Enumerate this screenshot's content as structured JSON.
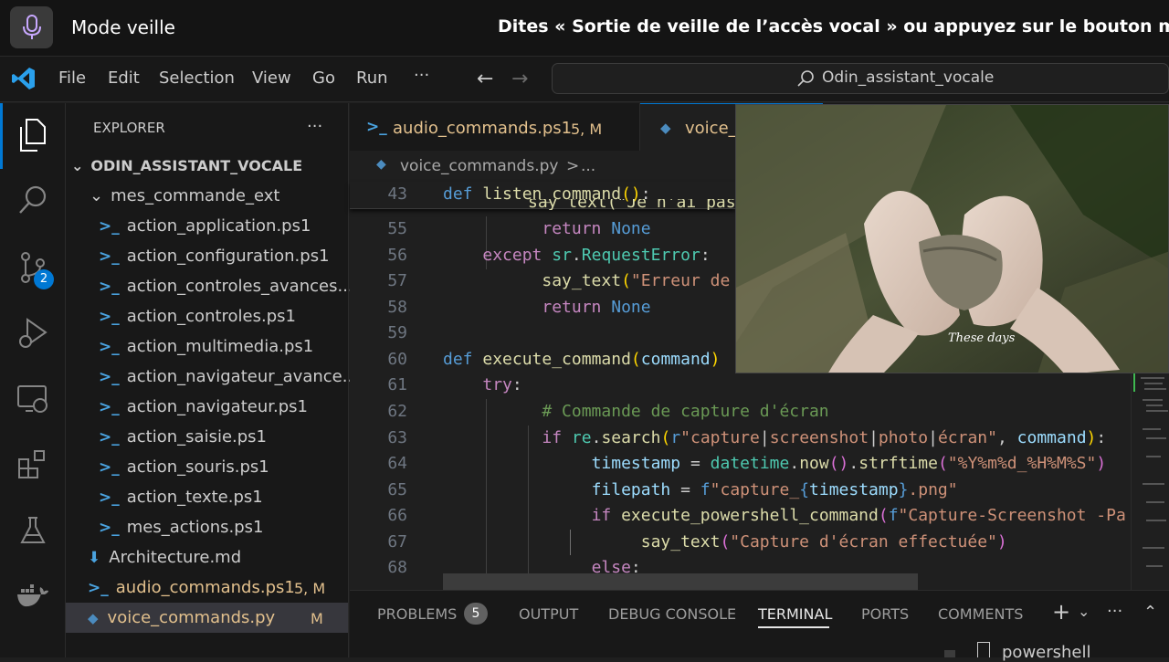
{
  "voice_bar": {
    "mode": "Mode veille",
    "hint": "Dites « Sortie de veille de l’accès vocal » ou appuyez sur le bouton micro pour"
  },
  "menu": {
    "items": [
      "File",
      "Edit",
      "Selection",
      "View",
      "Go",
      "Run",
      "···"
    ],
    "search_text": "Odin_assistant_vocale"
  },
  "explorer": {
    "title": "EXPLORER",
    "more": "···",
    "root": "ODIN_ASSISTANT_VOCALE",
    "folder": "mes_commande_ext",
    "files": [
      "action_application.ps1",
      "action_configuration.ps1",
      "action_controles_avances....",
      "action_controles.ps1",
      "action_multimedia.ps1",
      "action_navigateur_avance....",
      "action_navigateur.ps1",
      "action_saisie.ps1",
      "action_souris.ps1",
      "action_texte.ps1",
      "mes_actions.ps1"
    ],
    "architecture": "Architecture.md",
    "audio_file": "audio_commands.ps1",
    "audio_badge": "5, M",
    "voice_file": "voice_commands.py",
    "voice_badge": "M"
  },
  "activity": {
    "scm_badge": "2"
  },
  "tabs": {
    "tab1_label": "audio_commands.ps1",
    "tab1_badge": "5, M",
    "tab2_label": "voice_c"
  },
  "breadcrumb": {
    "file": "voice_commands.py",
    "sep": ">",
    "rest": "..."
  },
  "code": {
    "sticky_line": "43",
    "line_numbers": [
      "55",
      "56",
      "57",
      "58",
      "59",
      "60",
      "61",
      "62",
      "63",
      "64",
      "65",
      "66",
      "67",
      "68"
    ]
  },
  "video": {
    "caption": "These days"
  },
  "panel": {
    "tabs": [
      "PROBLEMS",
      "OUTPUT",
      "DEBUG CONSOLE",
      "TERMINAL",
      "PORTS",
      "COMMENTS"
    ],
    "problems_count": "5",
    "terminal_item": "powershell"
  },
  "colors": {
    "accent": "#0078d4",
    "modified": "#e2c08d",
    "badge": "#0078d4"
  }
}
